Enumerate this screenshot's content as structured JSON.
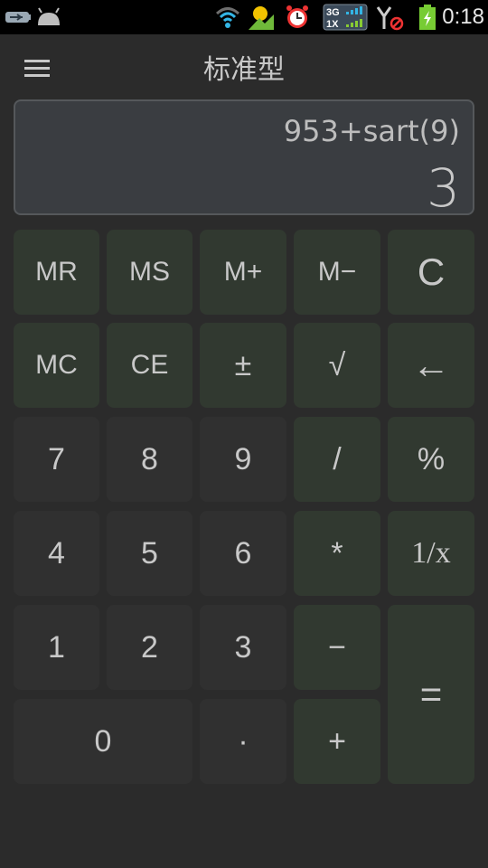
{
  "status_bar": {
    "icons": [
      "usb-icon",
      "android-debug-icon",
      "wifi-icon",
      "weather-icon",
      "alarm-icon",
      "signal-3g-1x-icon",
      "no-signal-icon",
      "battery-charging-icon"
    ],
    "time": "0:18"
  },
  "app_bar": {
    "menu_icon": "hamburger-menu-icon",
    "title": "标准型"
  },
  "display": {
    "expression": "953+sart(9)",
    "result": "3"
  },
  "keypad": {
    "rows": [
      [
        "MR",
        "MS",
        "M+",
        "M−",
        "C"
      ],
      [
        "MC",
        "CE",
        "±",
        "√",
        "←"
      ],
      [
        "7",
        "8",
        "9",
        "/",
        "%"
      ],
      [
        "4",
        "5",
        "6",
        "*",
        "1/x"
      ],
      [
        "1",
        "2",
        "3",
        "−",
        "="
      ],
      [
        "0",
        "·",
        "+"
      ]
    ]
  },
  "colors": {
    "background": "#2b2b2b",
    "function_key": "#313930",
    "number_key": "#303030",
    "display_bg": "#3a3d41",
    "text": "#c8c8c8"
  }
}
